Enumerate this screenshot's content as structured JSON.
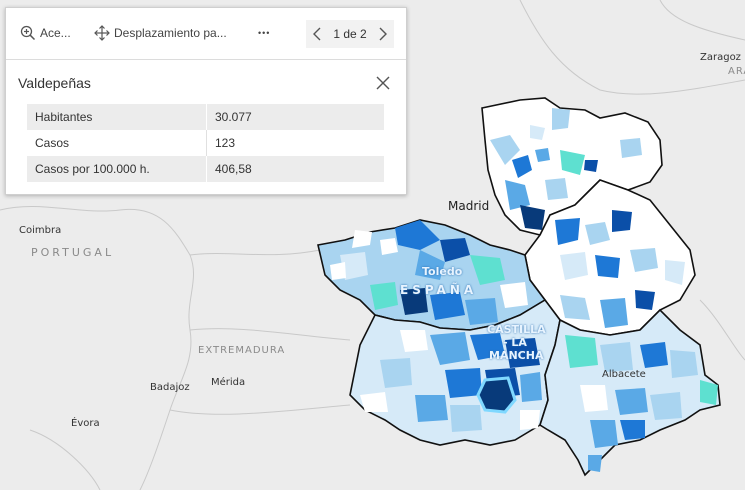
{
  "popup": {
    "tools": {
      "zoom_label": "Ace...",
      "pan_label": "Desplazamiento pa...",
      "more_label": "•••"
    },
    "pager": {
      "label": "1 de 2"
    },
    "title": "Valdepeñas",
    "attributes": [
      {
        "key": "Habitantes",
        "value": "30.077"
      },
      {
        "key": "Casos",
        "value": "123"
      },
      {
        "key": "Casos por 100.000 h.",
        "value": "406,58"
      }
    ]
  },
  "map": {
    "labels": {
      "zaragoza": "Zaragoz",
      "ara": "ARA",
      "madrid": "Madrid",
      "coimbra": "Coimbra",
      "portugal": "PORTUGAL",
      "extremadura": "EXTREMADURA",
      "badajoz": "Badajoz",
      "merida": "Mérida",
      "evora": "Évora",
      "toledo": "Toledo",
      "espana": "ESPAÑA",
      "clm1": "CASTILLA",
      "clm2": "- LA",
      "clm3": "MANCHA",
      "albacete": "Albacete"
    },
    "colors": {
      "background": "#ececec",
      "very_light": "#d6eaf8",
      "light": "#a9d4f0",
      "medium": "#5aa9e6",
      "strong": "#1e78d6",
      "dark": "#0b4fa8",
      "darkest": "#083a7a",
      "teal": "#5ee0d0",
      "highlight": "#7fd8ff",
      "border": "#111111"
    }
  }
}
